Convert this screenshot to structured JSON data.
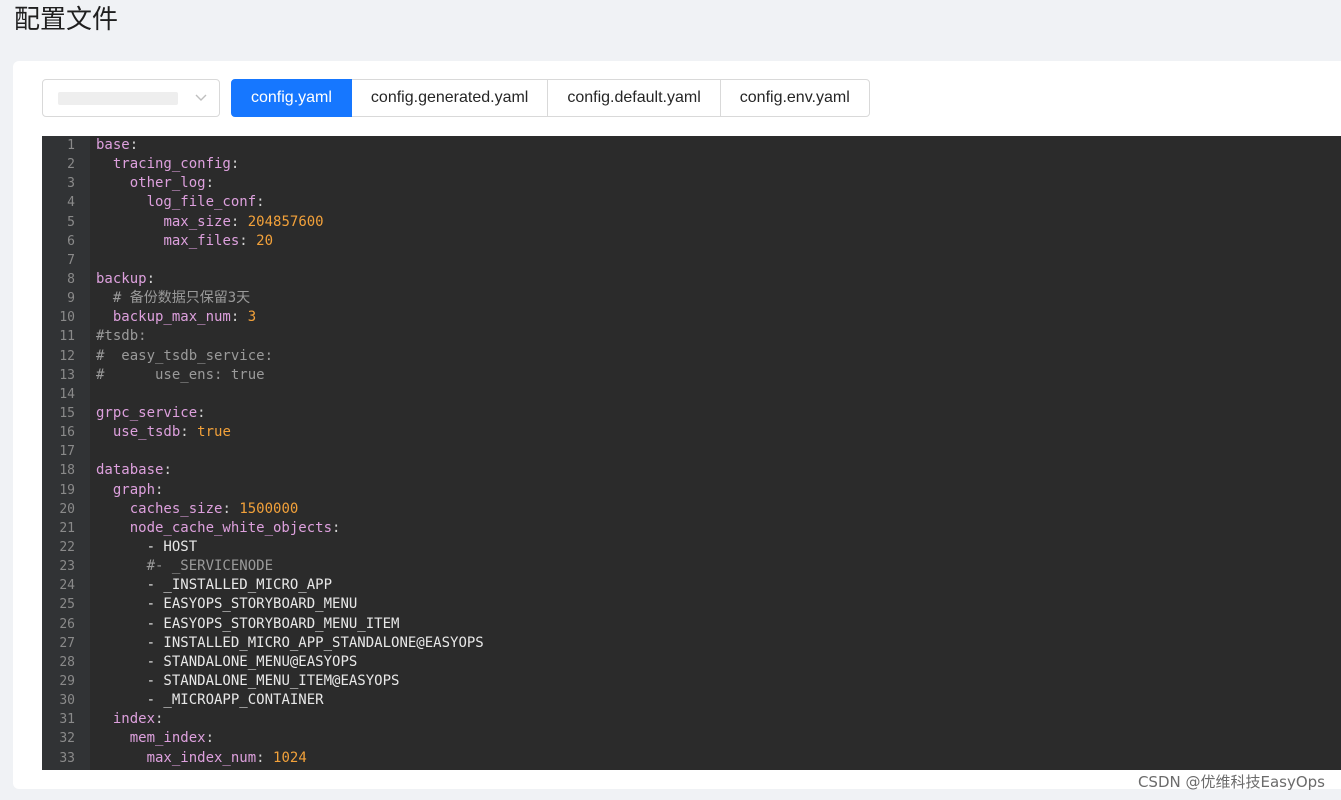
{
  "page": {
    "title": "配置文件",
    "watermark": "CSDN @优维科技EasyOps"
  },
  "selector": {
    "value": "",
    "icon": "chevron-down-icon"
  },
  "tabs": [
    {
      "label": "config.yaml",
      "active": true
    },
    {
      "label": "config.generated.yaml",
      "active": false
    },
    {
      "label": "config.default.yaml",
      "active": false
    },
    {
      "label": "config.env.yaml",
      "active": false
    }
  ],
  "colors": {
    "accent": "#1677ff",
    "editor_bg": "#2b2b2b",
    "key": "#dda0dd",
    "number": "#f2a13a",
    "comment": "#9a9a9a"
  },
  "editor": {
    "lines": [
      {
        "num": "1",
        "code": "base:"
      },
      {
        "num": "2",
        "code": "  tracing_config:"
      },
      {
        "num": "3",
        "code": "    other_log:"
      },
      {
        "num": "4",
        "code": "      log_file_conf:"
      },
      {
        "num": "5",
        "code": "        max_size: 204857600"
      },
      {
        "num": "6",
        "code": "        max_files: 20"
      },
      {
        "num": "7",
        "code": ""
      },
      {
        "num": "8",
        "code": "backup:"
      },
      {
        "num": "9",
        "code": "  # 备份数据只保留3天"
      },
      {
        "num": "10",
        "code": "  backup_max_num: 3"
      },
      {
        "num": "11",
        "code": "#tsdb:"
      },
      {
        "num": "12",
        "code": "#  easy_tsdb_service:"
      },
      {
        "num": "13",
        "code": "#      use_ens: true"
      },
      {
        "num": "14",
        "code": ""
      },
      {
        "num": "15",
        "code": "grpc_service:"
      },
      {
        "num": "16",
        "code": "  use_tsdb: true"
      },
      {
        "num": "17",
        "code": ""
      },
      {
        "num": "18",
        "code": "database:"
      },
      {
        "num": "19",
        "code": "  graph:"
      },
      {
        "num": "20",
        "code": "    caches_size: 1500000"
      },
      {
        "num": "21",
        "code": "    node_cache_white_objects:"
      },
      {
        "num": "22",
        "code": "      - HOST"
      },
      {
        "num": "23",
        "code": "      #- _SERVICENODE"
      },
      {
        "num": "24",
        "code": "      - _INSTALLED_MICRO_APP"
      },
      {
        "num": "25",
        "code": "      - EASYOPS_STORYBOARD_MENU"
      },
      {
        "num": "26",
        "code": "      - EASYOPS_STORYBOARD_MENU_ITEM"
      },
      {
        "num": "27",
        "code": "      - INSTALLED_MICRO_APP_STANDALONE@EASYOPS"
      },
      {
        "num": "28",
        "code": "      - STANDALONE_MENU@EASYOPS"
      },
      {
        "num": "29",
        "code": "      - STANDALONE_MENU_ITEM@EASYOPS"
      },
      {
        "num": "30",
        "code": "      - _MICROAPP_CONTAINER"
      },
      {
        "num": "31",
        "code": "  index:"
      },
      {
        "num": "32",
        "code": "    mem_index:"
      },
      {
        "num": "33",
        "code": "      max_index_num: 1024"
      }
    ]
  }
}
